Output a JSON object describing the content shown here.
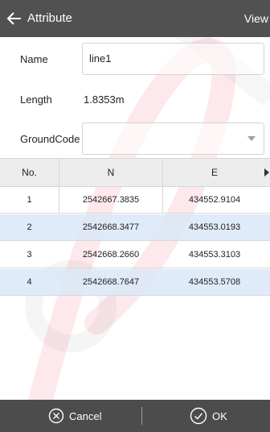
{
  "header": {
    "title": "Attribute",
    "view_label": "View"
  },
  "form": {
    "name_label": "Name",
    "name_value": "line1",
    "length_label": "Length",
    "length_value": "1.8353m",
    "groundcode_label": "GroundCode",
    "groundcode_value": ""
  },
  "table": {
    "columns": [
      "No.",
      "N",
      "E"
    ],
    "rows": [
      {
        "no": "1",
        "n": "2542667.3835",
        "e": "434552.9104"
      },
      {
        "no": "2",
        "n": "2542668.3477",
        "e": "434553.0193"
      },
      {
        "no": "3",
        "n": "2542668.2660",
        "e": "434553.3103"
      },
      {
        "no": "4",
        "n": "2542668.7647",
        "e": "434553.5708"
      }
    ]
  },
  "footer": {
    "cancel_label": "Cancel",
    "ok_label": "OK"
  },
  "colors": {
    "titlebar": "#515151",
    "bottombar": "#4c4c4c",
    "row_highlight": "#dbe8f8",
    "watermark": "#e8001c"
  },
  "icons": {
    "back": "back-arrow-icon",
    "dropdown": "chevron-down-icon",
    "scroll": "scroll-right-icon",
    "cancel": "circle-x-icon",
    "ok": "circle-check-icon"
  }
}
